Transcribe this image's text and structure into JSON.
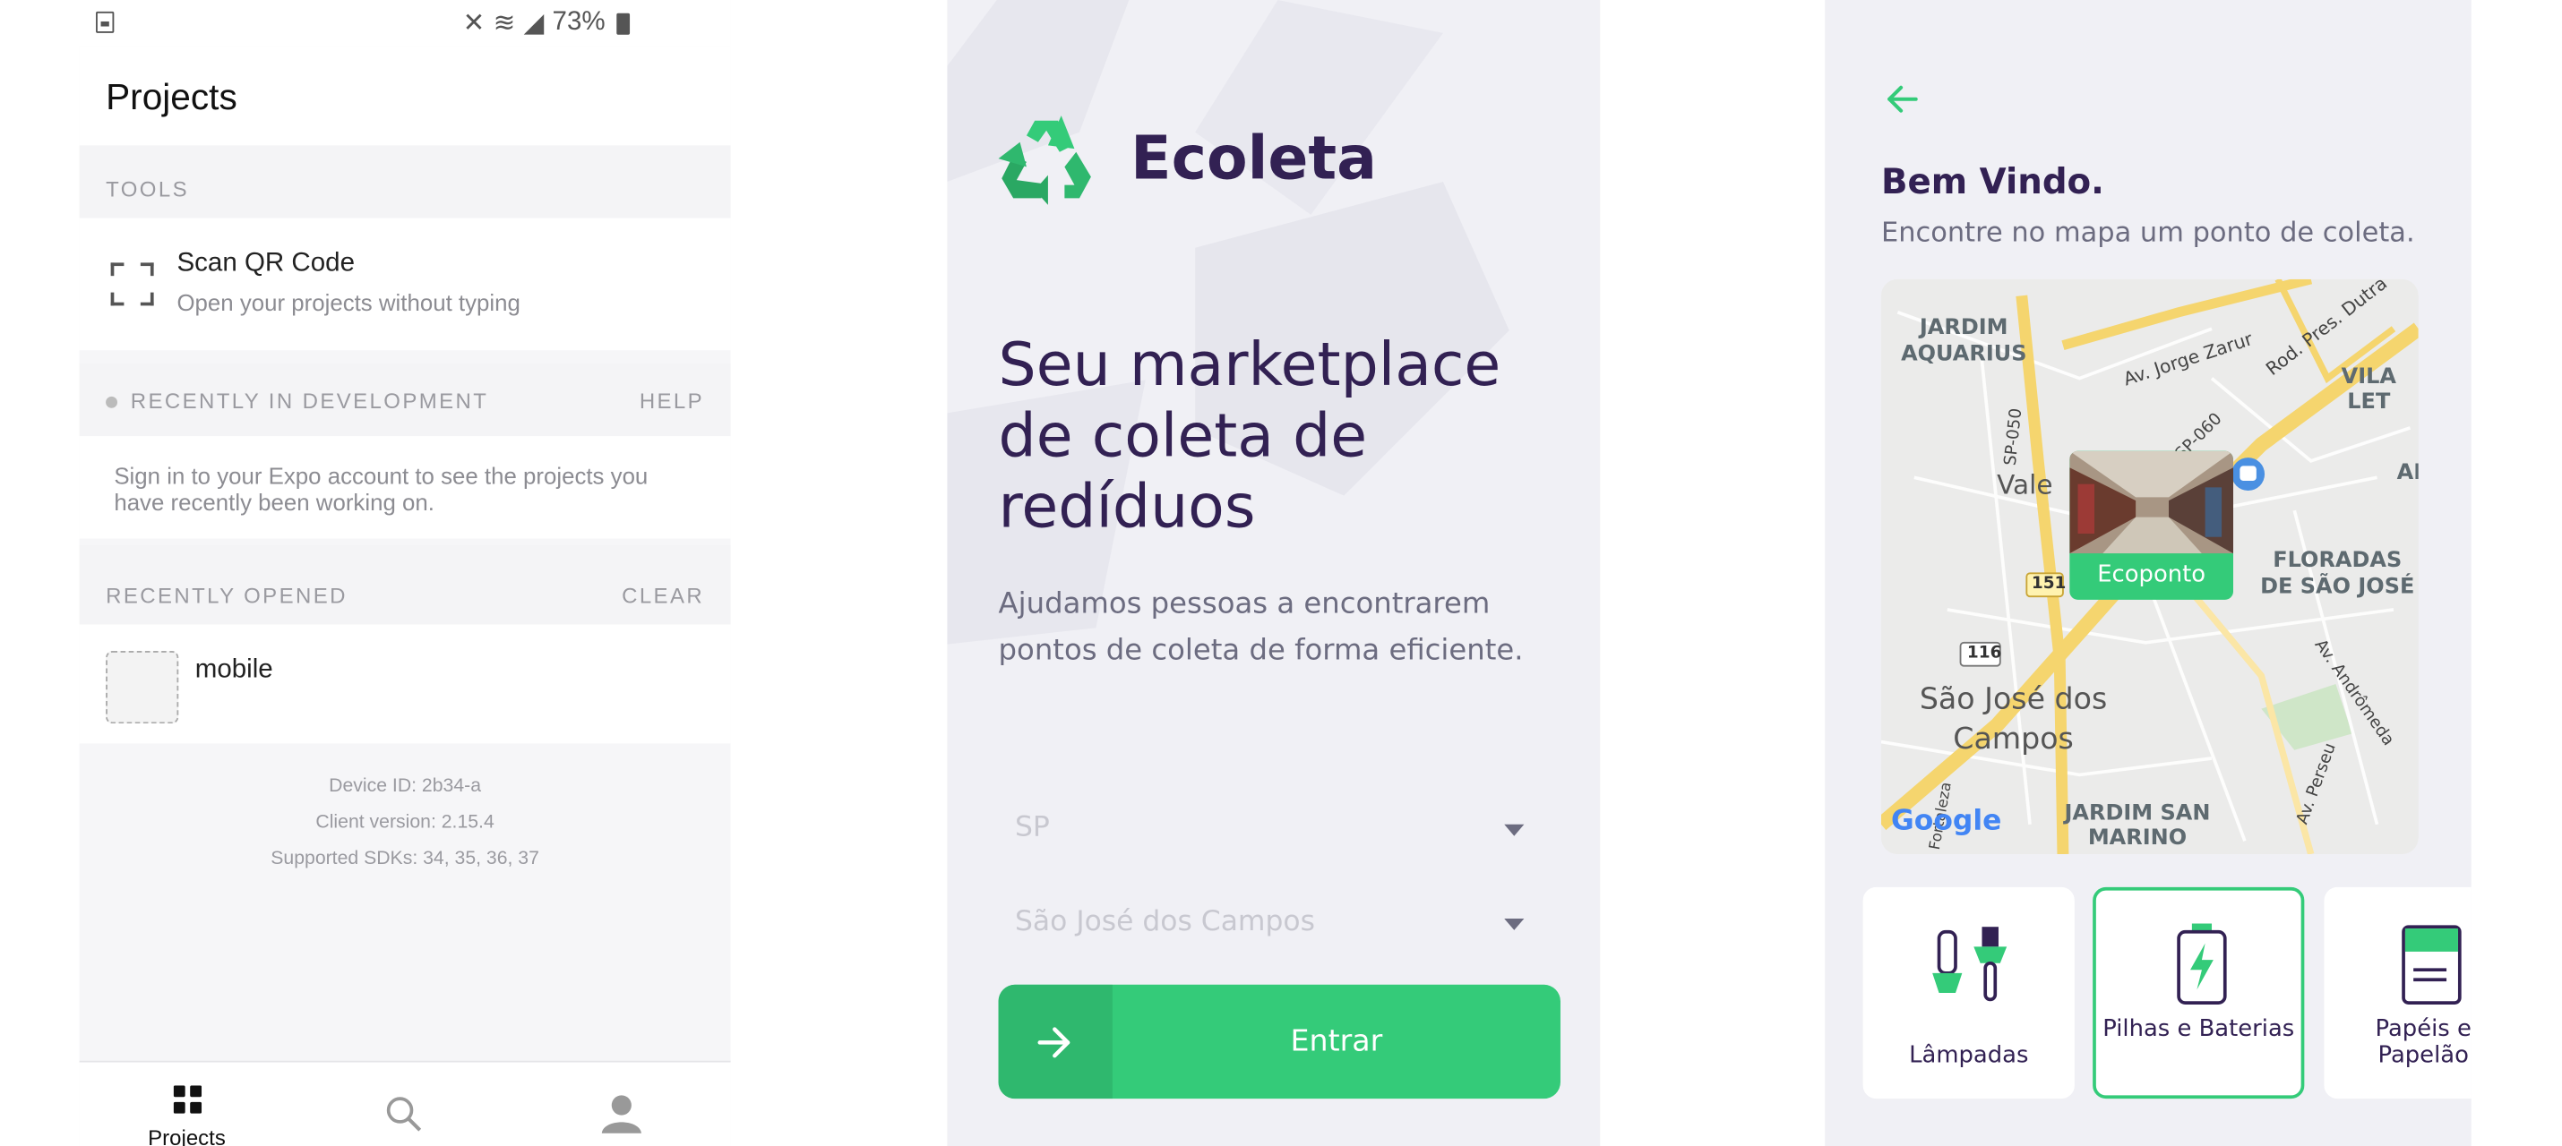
{
  "expo": {
    "status": {
      "battery": "73%"
    },
    "title": "Projects",
    "tools_header": "TOOLS",
    "scan": {
      "title": "Scan QR Code",
      "subtitle": "Open your projects without typing"
    },
    "recent_dev": {
      "header": "RECENTLY IN DEVELOPMENT",
      "help": "HELP",
      "message": "Sign in to your Expo account to see the projects you have recently been working on."
    },
    "recent_opened": {
      "header": "RECENTLY OPENED",
      "clear": "CLEAR",
      "project": "mobile"
    },
    "device": {
      "id": "Device ID: 2b34-a",
      "client": "Client version: 2.15.4",
      "sdks": "Supported SDKs: 34, 35, 36, 37"
    },
    "tabs": {
      "projects": "Projects"
    }
  },
  "ecoleta_home": {
    "brand": "Ecoleta",
    "hero": "Seu marketplace de coleta de redíduos",
    "subtitle": "Ajudamos pessoas a encontrarem pontos de coleta de forma eficiente.",
    "uf_value": "SP",
    "city_value": "São José dos Campos",
    "enter": "Entrar"
  },
  "ecoleta_map": {
    "title": "Bem Vindo.",
    "subtitle": "Encontre no mapa um ponto de coleta.",
    "map": {
      "labels": {
        "jardim_aquarius": "JARDIM AQUARIUS",
        "vila": "VILA LET",
        "floradas": "FLORADAS DE SÃO JOSÉ",
        "sjc": "São José dos Campos",
        "jardim_san_marino": "JARDIM SAN MARINO",
        "av_jorge": "Av. Jorge Zarur",
        "rod_dutra": "Rod. Pres. Dutra",
        "sp050": "SP-050",
        "sp060": "SP-060",
        "av_andromeda": "Av. Andrômeda",
        "av_perseu": "Av. Perseu",
        "vale": "Vale",
        "ab": "AB",
        "r151": "151",
        "r116": "116",
        "google": "Google",
        "fo": "Fortaleza"
      },
      "marker": "Ecoponto"
    },
    "items": [
      "Lâmpadas",
      "Pilhas e Baterias",
      "Papéis e Papelão"
    ]
  },
  "colors": {
    "green": "#34cb79",
    "purple": "#322153",
    "muted": "#6c6c80"
  }
}
